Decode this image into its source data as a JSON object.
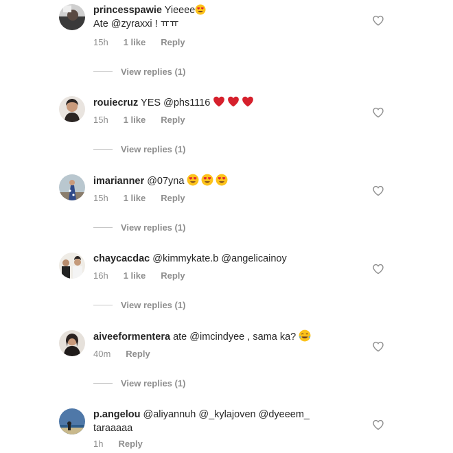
{
  "comments": [
    {
      "username": "princesspawie",
      "text_line1": "Yieeee",
      "emoji1": "heart-eyes",
      "line2_prefix": "Ate ",
      "line2_mention": "@zyraxxi",
      "line2_suffix": " ! ㅠㅠ",
      "time": "15h",
      "likes": "1 like",
      "reply": "Reply",
      "view_replies": "View replies (1)"
    },
    {
      "username": "rouiecruz",
      "text": "YES ",
      "mention": "@phs1116",
      "emojis": [
        "red-heart",
        "red-heart",
        "red-heart"
      ],
      "time": "15h",
      "likes": "1 like",
      "reply": "Reply",
      "view_replies": "View replies (1)"
    },
    {
      "username": "imarianner",
      "mention": "@07yna",
      "emojis": [
        "heart-eyes",
        "heart-eyes",
        "heart-eyes"
      ],
      "time": "15h",
      "likes": "1 like",
      "reply": "Reply",
      "view_replies": "View replies (1)"
    },
    {
      "username": "chaycacdac",
      "mention1": "@kimmykate.b",
      "mention2": "@angelicainoy",
      "time": "16h",
      "likes": "1 like",
      "reply": "Reply",
      "view_replies": "View replies (1)"
    },
    {
      "username": "aiveeformentera",
      "text_prefix": "ate ",
      "mention": "@imcindyee",
      "text_suffix": " , sama ka?",
      "emoji": "tears-of-joy",
      "time": "40m",
      "reply": "Reply",
      "view_replies": "View replies (1)"
    },
    {
      "username": "p.angelou",
      "mention1": "@aliyannuh",
      "mention2": "@_kylajoven",
      "mention3": "@dyeeem_",
      "line2": "taraaaaa",
      "time": "1h",
      "reply": "Reply"
    }
  ],
  "colors": {
    "text": "#262626",
    "meta": "#8e8e8e",
    "heart_outline": "#8e8e8e",
    "red_heart": "#d6202c",
    "emoji_yellow": "#fcc21b"
  }
}
